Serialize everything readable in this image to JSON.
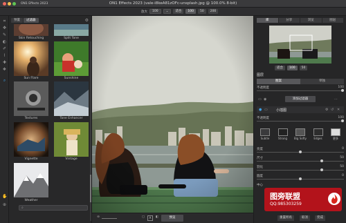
{
  "window": {
    "title": "ON1 Effects 2023 (vale-i8keA81zOFc-unsplash.jpg @ 100.0% 8-bit)",
    "app_label": "ON1 Effects 2023"
  },
  "toolbar": {
    "zoom_label": "放大",
    "zoom_value": "100",
    "fit_label": "适合",
    "zoom_100": "100",
    "zoom_50": "50",
    "zoom_200": "200"
  },
  "browser": {
    "tabs": [
      "预置",
      "过滤器"
    ],
    "active_tab": 1,
    "items": [
      {
        "label": "Skin Retouching"
      },
      {
        "label": "Split Tone"
      },
      {
        "label": "Sun Flare"
      },
      {
        "label": "Sunshine"
      },
      {
        "label": "Textures"
      },
      {
        "label": "Tone Enhancer"
      },
      {
        "label": "Vignette"
      },
      {
        "label": "Vintage"
      },
      {
        "label": "Weather"
      }
    ],
    "search_placeholder": ""
  },
  "right_panel": {
    "tabs": [
      "库",
      "分享",
      "浏览",
      "图层"
    ],
    "active_tab": 0,
    "navigator_zoom": {
      "fit": "适合",
      "v100": "100",
      "v50": "50"
    },
    "layers_title": "图层",
    "layer_seg": [
      "图案",
      "单独"
    ],
    "opacity_label": "不透明度",
    "opacity_value": "100",
    "add_filter_label": "添加过滤器",
    "filter_name": "小插图",
    "filter_opacity_label": "不透明度",
    "filter_opacity_value": "100",
    "presets": [
      {
        "label": "Subtle"
      },
      {
        "label": "Strong"
      },
      {
        "label": "Big Softy"
      },
      {
        "label": "Edges"
      },
      {
        "label": "更多"
      }
    ],
    "sliders": [
      {
        "label": "亮度",
        "value": "0"
      },
      {
        "label": "尺寸",
        "value": "50"
      },
      {
        "label": "羽化",
        "value": "50"
      },
      {
        "label": "圆度",
        "value": "0"
      },
      {
        "label": "中心",
        "value": ""
      }
    ],
    "footer": {
      "reset": "重置所有",
      "cancel": "取消",
      "done": "完成"
    }
  },
  "bottombar": {
    "preview_label": "预览"
  },
  "watermark": {
    "line1": "图旁联盟",
    "line2": "QQ:985303259"
  },
  "colors": {
    "accent": "#3ea1e6",
    "panel": "#262627",
    "watermark": "#b3131b"
  }
}
